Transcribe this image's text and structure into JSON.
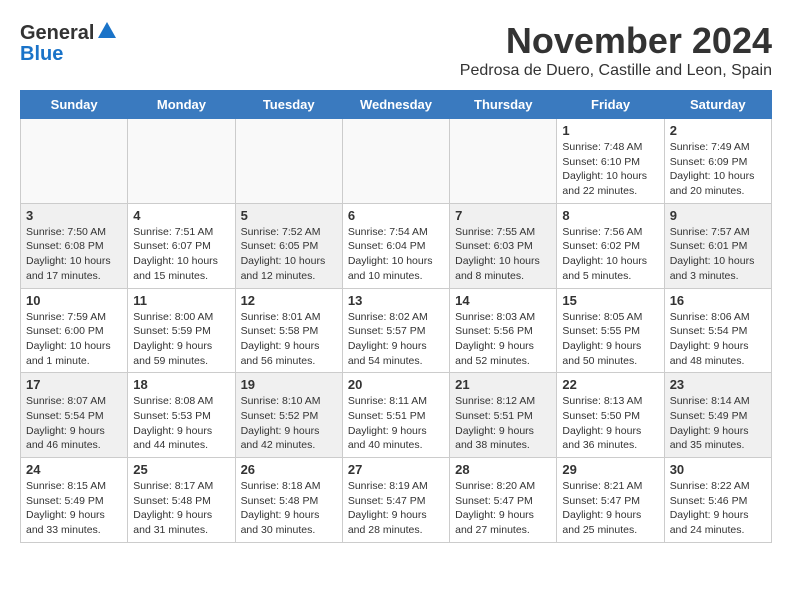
{
  "logo": {
    "general": "General",
    "blue": "Blue"
  },
  "title": "November 2024",
  "subtitle": "Pedrosa de Duero, Castille and Leon, Spain",
  "days_of_week": [
    "Sunday",
    "Monday",
    "Tuesday",
    "Wednesday",
    "Thursday",
    "Friday",
    "Saturday"
  ],
  "weeks": [
    [
      {
        "day": "",
        "info": "",
        "empty": true
      },
      {
        "day": "",
        "info": "",
        "empty": true
      },
      {
        "day": "",
        "info": "",
        "empty": true
      },
      {
        "day": "",
        "info": "",
        "empty": true
      },
      {
        "day": "",
        "info": "",
        "empty": true
      },
      {
        "day": "1",
        "info": "Sunrise: 7:48 AM\nSunset: 6:10 PM\nDaylight: 10 hours and 22 minutes."
      },
      {
        "day": "2",
        "info": "Sunrise: 7:49 AM\nSunset: 6:09 PM\nDaylight: 10 hours and 20 minutes."
      }
    ],
    [
      {
        "day": "3",
        "info": "Sunrise: 7:50 AM\nSunset: 6:08 PM\nDaylight: 10 hours and 17 minutes."
      },
      {
        "day": "4",
        "info": "Sunrise: 7:51 AM\nSunset: 6:07 PM\nDaylight: 10 hours and 15 minutes."
      },
      {
        "day": "5",
        "info": "Sunrise: 7:52 AM\nSunset: 6:05 PM\nDaylight: 10 hours and 12 minutes."
      },
      {
        "day": "6",
        "info": "Sunrise: 7:54 AM\nSunset: 6:04 PM\nDaylight: 10 hours and 10 minutes."
      },
      {
        "day": "7",
        "info": "Sunrise: 7:55 AM\nSunset: 6:03 PM\nDaylight: 10 hours and 8 minutes."
      },
      {
        "day": "8",
        "info": "Sunrise: 7:56 AM\nSunset: 6:02 PM\nDaylight: 10 hours and 5 minutes."
      },
      {
        "day": "9",
        "info": "Sunrise: 7:57 AM\nSunset: 6:01 PM\nDaylight: 10 hours and 3 minutes."
      }
    ],
    [
      {
        "day": "10",
        "info": "Sunrise: 7:59 AM\nSunset: 6:00 PM\nDaylight: 10 hours and 1 minute."
      },
      {
        "day": "11",
        "info": "Sunrise: 8:00 AM\nSunset: 5:59 PM\nDaylight: 9 hours and 59 minutes."
      },
      {
        "day": "12",
        "info": "Sunrise: 8:01 AM\nSunset: 5:58 PM\nDaylight: 9 hours and 56 minutes."
      },
      {
        "day": "13",
        "info": "Sunrise: 8:02 AM\nSunset: 5:57 PM\nDaylight: 9 hours and 54 minutes."
      },
      {
        "day": "14",
        "info": "Sunrise: 8:03 AM\nSunset: 5:56 PM\nDaylight: 9 hours and 52 minutes."
      },
      {
        "day": "15",
        "info": "Sunrise: 8:05 AM\nSunset: 5:55 PM\nDaylight: 9 hours and 50 minutes."
      },
      {
        "day": "16",
        "info": "Sunrise: 8:06 AM\nSunset: 5:54 PM\nDaylight: 9 hours and 48 minutes."
      }
    ],
    [
      {
        "day": "17",
        "info": "Sunrise: 8:07 AM\nSunset: 5:54 PM\nDaylight: 9 hours and 46 minutes."
      },
      {
        "day": "18",
        "info": "Sunrise: 8:08 AM\nSunset: 5:53 PM\nDaylight: 9 hours and 44 minutes."
      },
      {
        "day": "19",
        "info": "Sunrise: 8:10 AM\nSunset: 5:52 PM\nDaylight: 9 hours and 42 minutes."
      },
      {
        "day": "20",
        "info": "Sunrise: 8:11 AM\nSunset: 5:51 PM\nDaylight: 9 hours and 40 minutes."
      },
      {
        "day": "21",
        "info": "Sunrise: 8:12 AM\nSunset: 5:51 PM\nDaylight: 9 hours and 38 minutes."
      },
      {
        "day": "22",
        "info": "Sunrise: 8:13 AM\nSunset: 5:50 PM\nDaylight: 9 hours and 36 minutes."
      },
      {
        "day": "23",
        "info": "Sunrise: 8:14 AM\nSunset: 5:49 PM\nDaylight: 9 hours and 35 minutes."
      }
    ],
    [
      {
        "day": "24",
        "info": "Sunrise: 8:15 AM\nSunset: 5:49 PM\nDaylight: 9 hours and 33 minutes."
      },
      {
        "day": "25",
        "info": "Sunrise: 8:17 AM\nSunset: 5:48 PM\nDaylight: 9 hours and 31 minutes."
      },
      {
        "day": "26",
        "info": "Sunrise: 8:18 AM\nSunset: 5:48 PM\nDaylight: 9 hours and 30 minutes."
      },
      {
        "day": "27",
        "info": "Sunrise: 8:19 AM\nSunset: 5:47 PM\nDaylight: 9 hours and 28 minutes."
      },
      {
        "day": "28",
        "info": "Sunrise: 8:20 AM\nSunset: 5:47 PM\nDaylight: 9 hours and 27 minutes."
      },
      {
        "day": "29",
        "info": "Sunrise: 8:21 AM\nSunset: 5:47 PM\nDaylight: 9 hours and 25 minutes."
      },
      {
        "day": "30",
        "info": "Sunrise: 8:22 AM\nSunset: 5:46 PM\nDaylight: 9 hours and 24 minutes."
      }
    ]
  ]
}
